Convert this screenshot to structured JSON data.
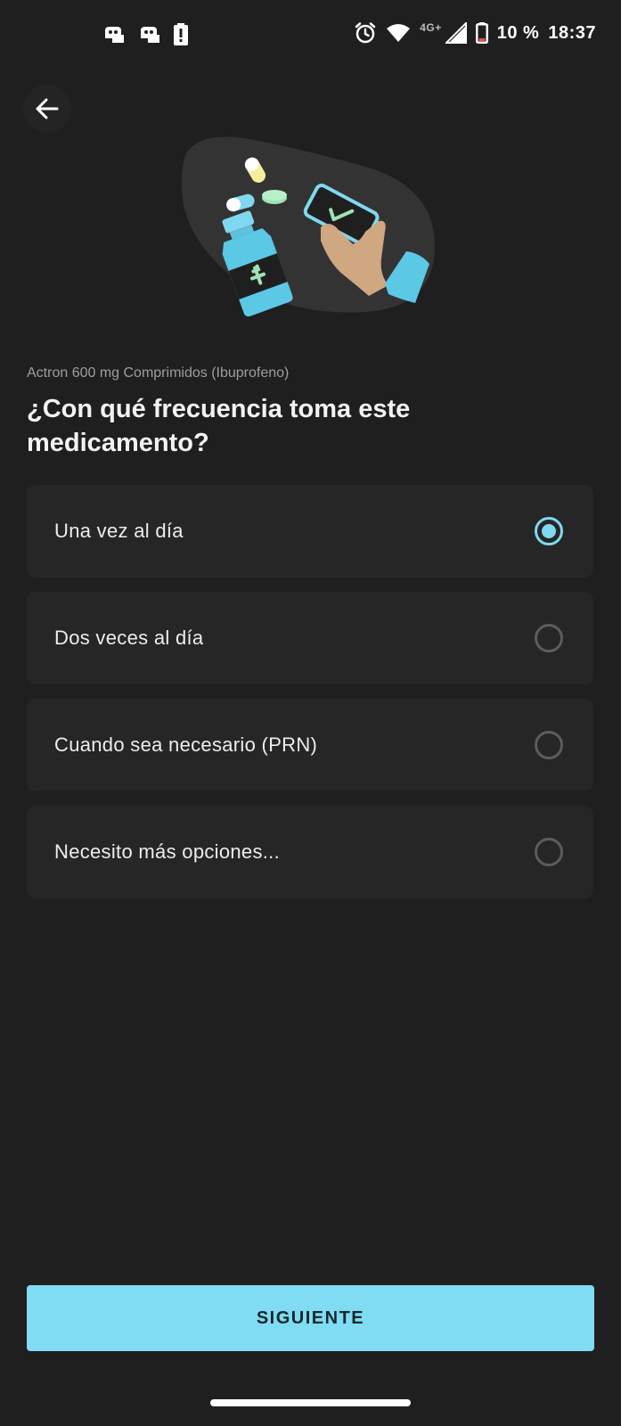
{
  "status_bar": {
    "network_type": "4G+",
    "battery": "10 %",
    "time": "18:37"
  },
  "header": {
    "medication": "Actron 600 mg Comprimidos (Ibuprofeno)",
    "question": "¿Con qué frecuencia toma este medicamento?"
  },
  "options": [
    {
      "label": "Una vez al día",
      "selected": true
    },
    {
      "label": "Dos veces al día",
      "selected": false
    },
    {
      "label": "Cuando sea necesario (PRN)",
      "selected": false
    },
    {
      "label": "Necesito más opciones...",
      "selected": false
    }
  ],
  "footer": {
    "next_label": "SIGUIENTE"
  },
  "colors": {
    "background": "#1f1f1f",
    "card": "#262626",
    "accent": "#80dcf2"
  },
  "icons": {
    "back": "arrow-left-icon",
    "radio_selected": "radio-checked-icon",
    "radio_unselected": "radio-unchecked-icon"
  }
}
